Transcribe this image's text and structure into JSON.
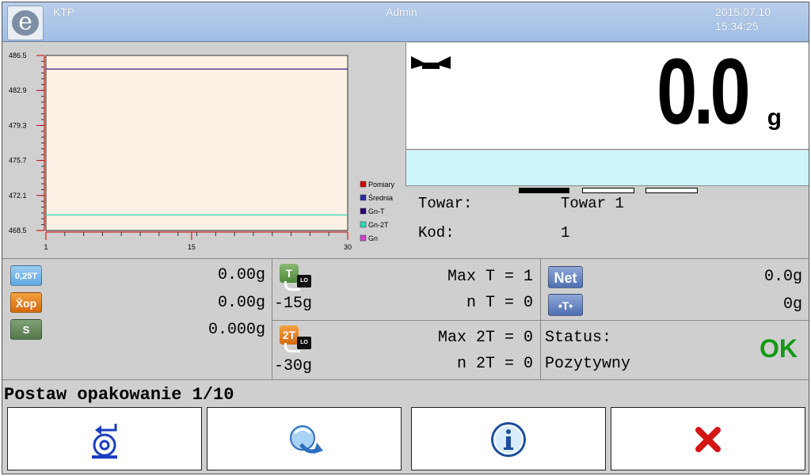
{
  "header": {
    "app": "KTP",
    "user": "Admin",
    "date": "2015.07.10",
    "time": "15:34:25"
  },
  "chart_data": {
    "type": "line",
    "x_ticks": [
      "1",
      "15",
      "30"
    ],
    "y_ticks": [
      "486.5",
      "482.9",
      "479.3",
      "475.7",
      "472.1",
      "468.5"
    ],
    "ylim": [
      468.5,
      486.5
    ],
    "xlim": [
      1,
      30
    ],
    "series": [
      {
        "name": "Pomiary",
        "color": "#cc0000",
        "values": []
      },
      {
        "name": "Średnia",
        "color": "#2a2aa0",
        "values": []
      },
      {
        "name": "Gn-T",
        "color": "#2b0070",
        "values": [
          485.1,
          485.1
        ]
      },
      {
        "name": "Gn-2T",
        "color": "#2fd6b4",
        "values": [
          470.1,
          470.1
        ]
      },
      {
        "name": "Gn",
        "color": "#cc44cc",
        "values": []
      }
    ]
  },
  "weight": {
    "value": "0.0",
    "unit": "g",
    "bargraph_fill": 0.33
  },
  "product": {
    "label_towar": "Towar:",
    "value_towar": "Towar 1",
    "label_kod": "Kod:",
    "value_kod": "1"
  },
  "stats": {
    "icon_025t": "0,25T",
    "icon_xop": "X̄op",
    "icon_s": "S",
    "val_025t": "0.00g",
    "val_xop": "0.00g",
    "val_s": "0.000g"
  },
  "thresholds": {
    "t_icon": "T",
    "t_lo": "LO",
    "t_value": "-15g",
    "max_t": "Max T = 1",
    "n_t": "n T = 0",
    "t2_icon": "2T",
    "t2_value": "-30g",
    "max_2t": "Max 2T = 0",
    "n_2t": "n 2T = 0"
  },
  "net_panel": {
    "net_icon": "Net",
    "net_value": "0.0g",
    "tare_icon": "•T•",
    "tare_value": "0g"
  },
  "status": {
    "label": "Status:",
    "value": "Pozytywny",
    "ok": "OK"
  },
  "prompt": "Postaw opakowanie 1/10",
  "buttons": [
    {
      "icon": "tare-icon"
    },
    {
      "icon": "rotate-icon"
    },
    {
      "icon": "info-icon"
    },
    {
      "icon": "cancel-icon"
    }
  ]
}
